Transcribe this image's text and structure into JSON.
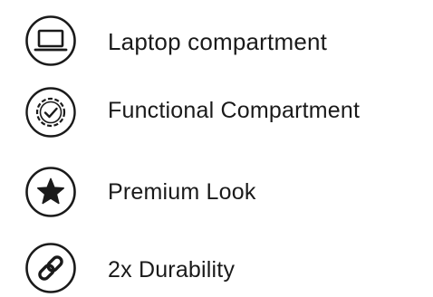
{
  "features": [
    {
      "label": "Laptop compartment",
      "icon": "laptop-icon"
    },
    {
      "label": "Functional Compartment",
      "icon": "gear-check-icon"
    },
    {
      "label": "Premium Look",
      "icon": "star-icon"
    },
    {
      "label": "2x Durability",
      "icon": "link-icon"
    }
  ],
  "colors": {
    "ink": "#1a1a1a",
    "background": "#ffffff"
  }
}
